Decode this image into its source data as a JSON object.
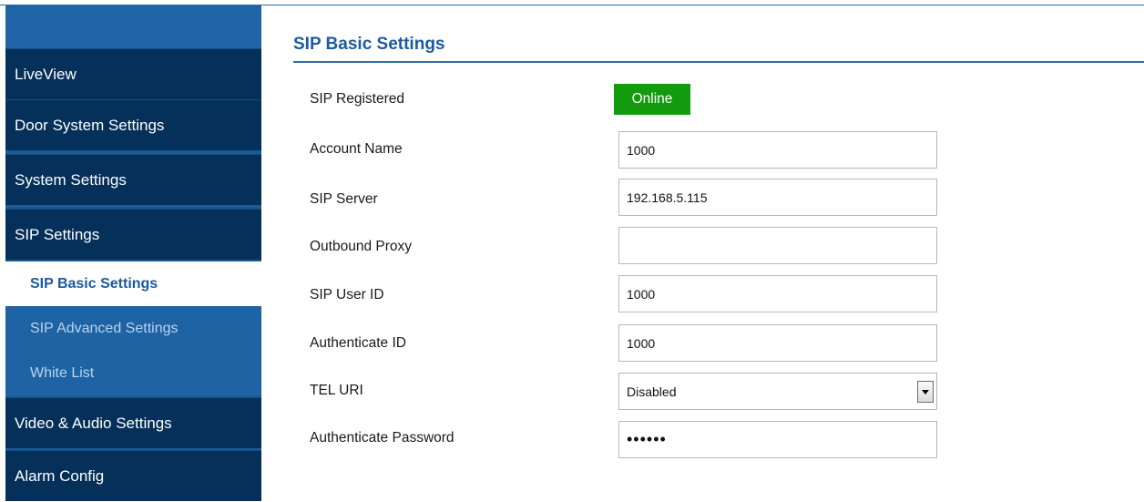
{
  "sidebar": {
    "items": [
      {
        "label": "LiveView"
      },
      {
        "label": "Door System Settings"
      },
      {
        "label": "System Settings"
      },
      {
        "label": "SIP Settings"
      },
      {
        "label": "Video & Audio Settings"
      },
      {
        "label": "Alarm Config"
      }
    ],
    "sub_items": [
      {
        "label": "SIP Basic Settings",
        "active": true
      },
      {
        "label": "SIP Advanced Settings",
        "active": false
      },
      {
        "label": "White List",
        "active": false
      }
    ]
  },
  "main": {
    "title": "SIP Basic Settings",
    "fields": {
      "sip_registered": {
        "label": "SIP Registered",
        "status": "Online",
        "status_color": "#139b0e"
      },
      "account_name": {
        "label": "Account Name",
        "value": "1000"
      },
      "sip_server": {
        "label": "SIP Server",
        "value": "192.168.5.115"
      },
      "outbound_proxy": {
        "label": "Outbound Proxy",
        "value": ""
      },
      "sip_user_id": {
        "label": "SIP User ID",
        "value": "1000"
      },
      "authenticate_id": {
        "label": "Authenticate ID",
        "value": "1000"
      },
      "tel_uri": {
        "label": "TEL URI",
        "value": "Disabled"
      },
      "authenticate_password": {
        "label": "Authenticate Password",
        "value": "••••••"
      }
    }
  },
  "colors": {
    "accent": "#1c5aa0",
    "sidebar_dark": "#043059",
    "sidebar_mid": "#1e63a4",
    "online": "#139b0e"
  }
}
